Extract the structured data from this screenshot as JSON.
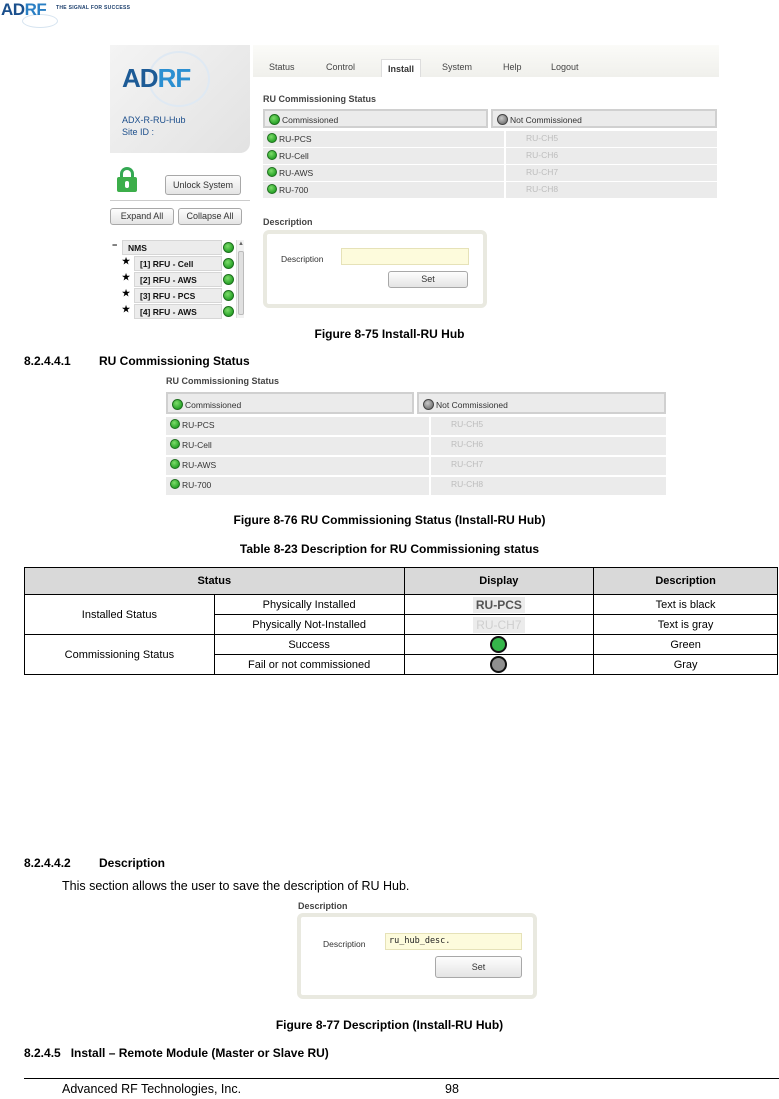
{
  "page_header": {
    "logo_text_1": "AD",
    "logo_text_2": "RF",
    "tagline": "THE SIGNAL FOR SUCCESS"
  },
  "figure_1": {
    "caption": "Figure 8-75    Install-RU Hub",
    "app": {
      "logo_text_1": "AD",
      "logo_text_2": "RF",
      "model": "ADX-R-RU-Hub",
      "site_id_label": "Site ID :",
      "tabs": [
        "Status",
        "Control",
        "Install",
        "System",
        "Help",
        "Logout"
      ],
      "active_tab": "Install",
      "unlock_button": "Unlock System",
      "expand_all_button": "Expand All",
      "collapse_all_button": "Collapse All",
      "tree": [
        {
          "marker": "−",
          "label": "NMS",
          "status": "green"
        },
        {
          "marker": "★",
          "label": "[1] RFU - Cell",
          "status": "green"
        },
        {
          "marker": "★",
          "label": "[2] RFU - AWS",
          "status": "green"
        },
        {
          "marker": "★",
          "label": "[3] RFU - PCS",
          "status": "green"
        },
        {
          "marker": "★",
          "label": "[4] RFU - AWS",
          "status": "green"
        }
      ],
      "description_section_title": "Description",
      "description_label": "Description",
      "description_value": "",
      "set_button": "Set"
    }
  },
  "ru_commissioning": {
    "title": "RU Commissioning Status",
    "legend": {
      "commissioned": "Commissioned",
      "not_commissioned": "Not Commissioned"
    },
    "rows": [
      {
        "left": "RU-PCS",
        "left_status": "green",
        "right": "RU-CH5"
      },
      {
        "left": "RU-Cell",
        "left_status": "green",
        "right": "RU-CH6"
      },
      {
        "left": "RU-AWS",
        "left_status": "green",
        "right": "RU-CH7"
      },
      {
        "left": "RU-700",
        "left_status": "green",
        "right": "RU-CH8"
      }
    ]
  },
  "section_8_2_4_4_1": {
    "number": "8.2.4.4.1",
    "title": "RU Commissioning Status"
  },
  "figure_2": {
    "caption": "Figure 8-76    RU Commissioning Status (Install-RU Hub)"
  },
  "table_8_23": {
    "caption": "Table 8-23     Description for RU Commissioning status",
    "headers": [
      "Status",
      "Display",
      "Description"
    ],
    "groups": [
      {
        "group": "Installed Status",
        "rows": [
          {
            "status": "Physically Installed",
            "display_text": "RU-PCS",
            "display_kind": "text-black",
            "description": "Text is black"
          },
          {
            "status": "Physically Not-Installed",
            "display_text": "RU-CH7",
            "display_kind": "text-gray",
            "description": "Text is gray"
          }
        ]
      },
      {
        "group": "Commissioning  Status",
        "rows": [
          {
            "status": "Success",
            "display_icon": "green-led",
            "description": "Green"
          },
          {
            "status": "Fail or not commissioned",
            "display_icon": "gray-led",
            "description": "Gray"
          }
        ]
      }
    ]
  },
  "section_8_2_4_4_2": {
    "number": "8.2.4.4.2",
    "title": "Description",
    "body": "This section allows the user to save the description of RU Hub."
  },
  "figure_3": {
    "caption": "Figure 8-77    Description (Install-RU Hub)",
    "section_title": "Description",
    "label": "Description",
    "value": "ru_hub_desc.",
    "set_button": "Set"
  },
  "section_8_2_4_5": {
    "number": "8.2.4.5",
    "title": "Install – Remote Module (Master or Slave RU)"
  },
  "footer": {
    "company": "Advanced RF Technologies, Inc.",
    "page_number": "98"
  },
  "colors": {
    "led_green": "#2aa52a",
    "led_gray": "#7d7d7d",
    "table_header_bg": "#d9d9d9",
    "input_bg": "#fdfbdc"
  }
}
